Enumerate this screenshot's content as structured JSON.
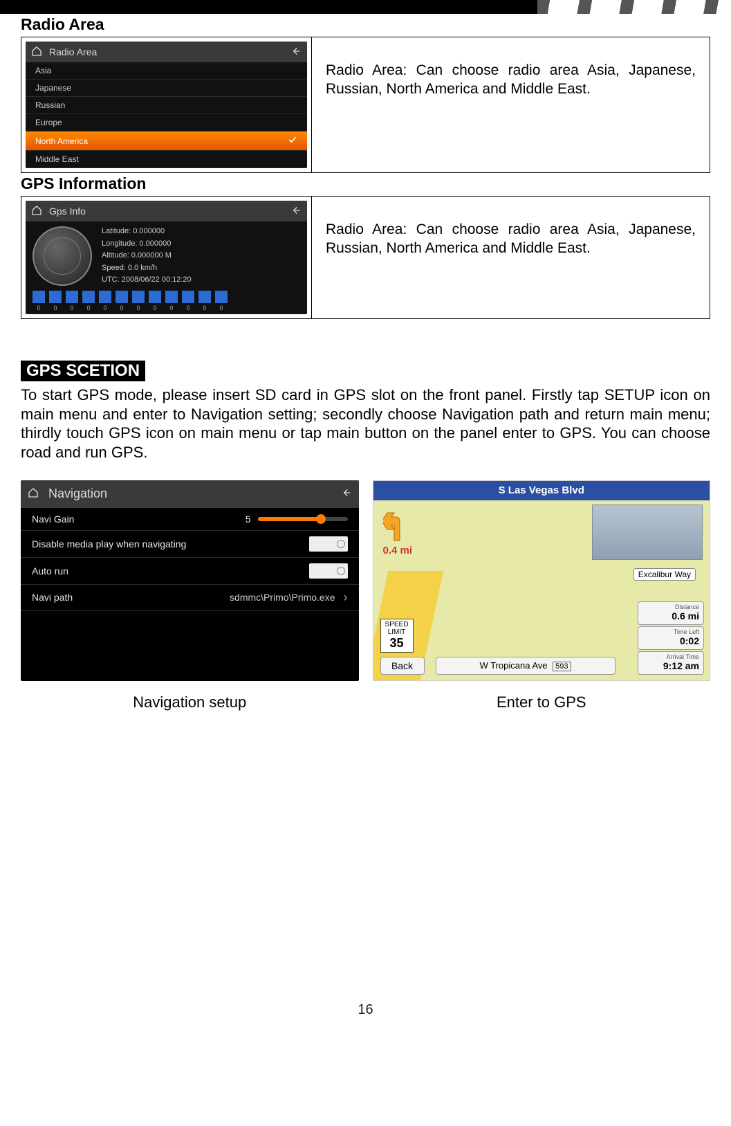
{
  "topbar": {},
  "section1": {
    "title": "Radio Area",
    "shot": {
      "header": "Radio Area",
      "items": [
        "Asia",
        "Japanese",
        "Russian",
        "Europe",
        "North America",
        "Middle East"
      ],
      "selected_index": 4
    },
    "desc": "Radio Area: Can choose radio area Asia, Japanese, Russian, North America and Middle East."
  },
  "section2": {
    "title": "GPS Information",
    "shot": {
      "header": "Gps Info",
      "fields": {
        "lat": "Latitude: 0.000000",
        "lon": "Longitude: 0.000000",
        "alt": "Altitude: 0.000000 M",
        "speed": "Speed: 0.0 km/h",
        "utc": "UTC: 2008/06/22 00:12:20"
      },
      "bars": [
        18,
        18,
        18,
        18,
        18,
        18,
        18,
        18,
        18,
        18,
        18,
        18
      ],
      "bar_labels": [
        "0",
        "0",
        "0",
        "0",
        "0",
        "0",
        "0",
        "0",
        "0",
        "0",
        "0",
        "0"
      ]
    },
    "desc": "Radio Area: Can choose radio area Asia, Japanese, Russian, North America and Middle East."
  },
  "gps_section": {
    "heading": "GPS SCETION",
    "body": "To start GPS mode, please insert SD card in GPS slot on the front panel. Firstly tap SETUP icon on main menu and enter to Navigation setting; secondly choose Navigation path and return main menu; thirdly touch GPS icon on main menu or tap main button on the panel enter to GPS. You can choose road and run GPS."
  },
  "nav_shot": {
    "header": "Navigation",
    "rows": {
      "gain_label": "Navi Gain",
      "gain_value": "5",
      "disable_label": "Disable media play when navigating",
      "autorun_label": "Auto run",
      "path_label": "Navi path",
      "path_value": "sdmmc\\Primo\\Primo.exe"
    },
    "caption": "Navigation setup"
  },
  "map_shot": {
    "top_road": "S Las Vegas Blvd",
    "turn_distance": "0.4 mi",
    "poi": "Excalibur Way",
    "speed_label": "SPEED LIMIT",
    "speed_value": "35",
    "back": "Back",
    "bottom_road": "W Tropicana Ave",
    "bottom_road_badge": "593",
    "info": {
      "dist_lbl": "Distance",
      "dist_val": "0.6 mi",
      "time_lbl": "Time Left",
      "time_val": "0:02",
      "arr_lbl": "Arrival Time",
      "arr_val": "9:12 am"
    },
    "caption": "Enter to GPS"
  },
  "page_number": "16"
}
